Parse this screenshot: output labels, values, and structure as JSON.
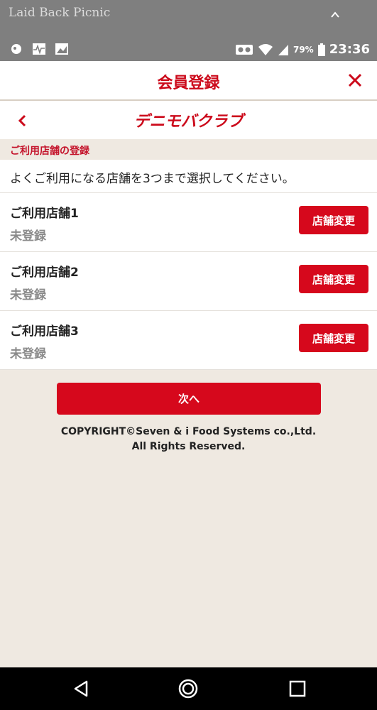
{
  "status_bar": {
    "notification_title": "Laid Back Picnic",
    "battery_percent": "79%",
    "time": "23:36",
    "icons": [
      "notification-icon",
      "activity-icon",
      "gallery-icon",
      "voicemail-icon",
      "wifi-icon",
      "signal-icon",
      "battery-icon"
    ]
  },
  "header": {
    "title": "会員登録"
  },
  "subheader": {
    "brand": "デニモバクラブ"
  },
  "section": {
    "label": "ご利用店舗の登録"
  },
  "instruction": "よくご利用になる店舗を3つまで選択してください。",
  "stores": [
    {
      "name": "ご利用店舗1",
      "status": "未登録",
      "button": "店舗変更"
    },
    {
      "name": "ご利用店舗2",
      "status": "未登録",
      "button": "店舗変更"
    },
    {
      "name": "ご利用店舗3",
      "status": "未登録",
      "button": "店舗変更"
    }
  ],
  "next_button": "次へ",
  "copyright": {
    "line1": "COPYRIGHT©Seven & i Food Systems co.,Ltd.",
    "line2": "All Rights Reserved."
  },
  "colors": {
    "accent": "#d6081c",
    "background": "#efe9e1",
    "status_bar": "#7f7f7f"
  }
}
